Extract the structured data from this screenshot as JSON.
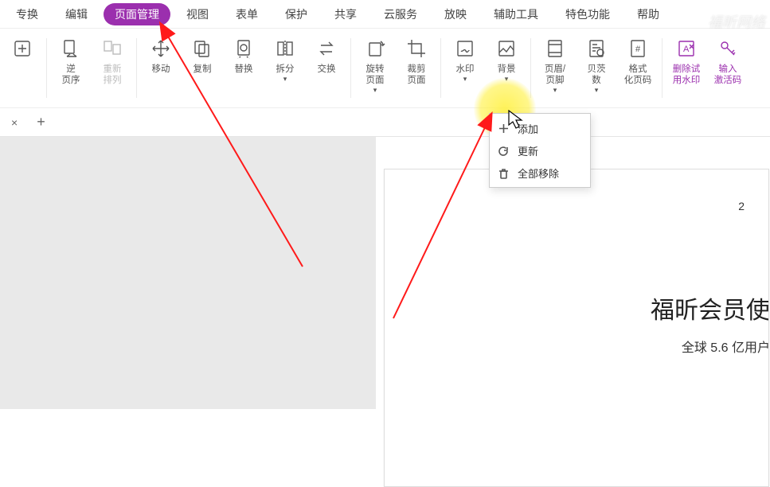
{
  "menu": {
    "items": [
      "专换",
      "编辑",
      "页面管理",
      "视图",
      "表单",
      "保护",
      "共享",
      "云服务",
      "放映",
      "辅助工具",
      "特色功能",
      "帮助"
    ],
    "active_index": 2
  },
  "ribbon": [
    {
      "label": "",
      "icon": "expand",
      "purple": false
    },
    {
      "label": "逆\n页序",
      "icon": "reverse",
      "purple": false
    },
    {
      "label": "重新\n排列",
      "icon": "rearrange",
      "disabled": true
    },
    {
      "label": "移动",
      "icon": "move",
      "purple": false
    },
    {
      "label": "复制",
      "icon": "copy",
      "purple": false
    },
    {
      "label": "替换",
      "icon": "replace",
      "purple": false
    },
    {
      "label": "拆分",
      "icon": "split",
      "caret": true
    },
    {
      "label": "交换",
      "icon": "swap",
      "purple": false
    },
    {
      "label": "旋转\n页面",
      "icon": "rotate",
      "caret": true
    },
    {
      "label": "裁剪\n页面",
      "icon": "crop",
      "purple": false
    },
    {
      "label": "水印",
      "icon": "watermark",
      "caret": true
    },
    {
      "label": "背景",
      "icon": "background",
      "caret": true
    },
    {
      "label": "页眉/\n页脚",
      "icon": "headerfooter",
      "caret": true,
      "highlight": true
    },
    {
      "label": "贝茨\n数",
      "icon": "bates",
      "caret": true
    },
    {
      "label": "格式\n化页码",
      "icon": "pagenum",
      "purple": false
    },
    {
      "label": "删除试\n用水印",
      "icon": "removewm",
      "purple": true
    },
    {
      "label": "输入\n激活码",
      "icon": "key",
      "purple": true
    }
  ],
  "dropdown": {
    "items": [
      {
        "label": "添加",
        "icon": "plus"
      },
      {
        "label": "更新",
        "icon": "refresh"
      },
      {
        "label": "全部移除",
        "icon": "trash"
      }
    ]
  },
  "tabstrip": {
    "close": "×",
    "add": "+"
  },
  "document": {
    "page_number": "2",
    "title": "福昕会员使",
    "subtitle": "全球 5.6 亿用户"
  },
  "watermark": "福昕网络"
}
